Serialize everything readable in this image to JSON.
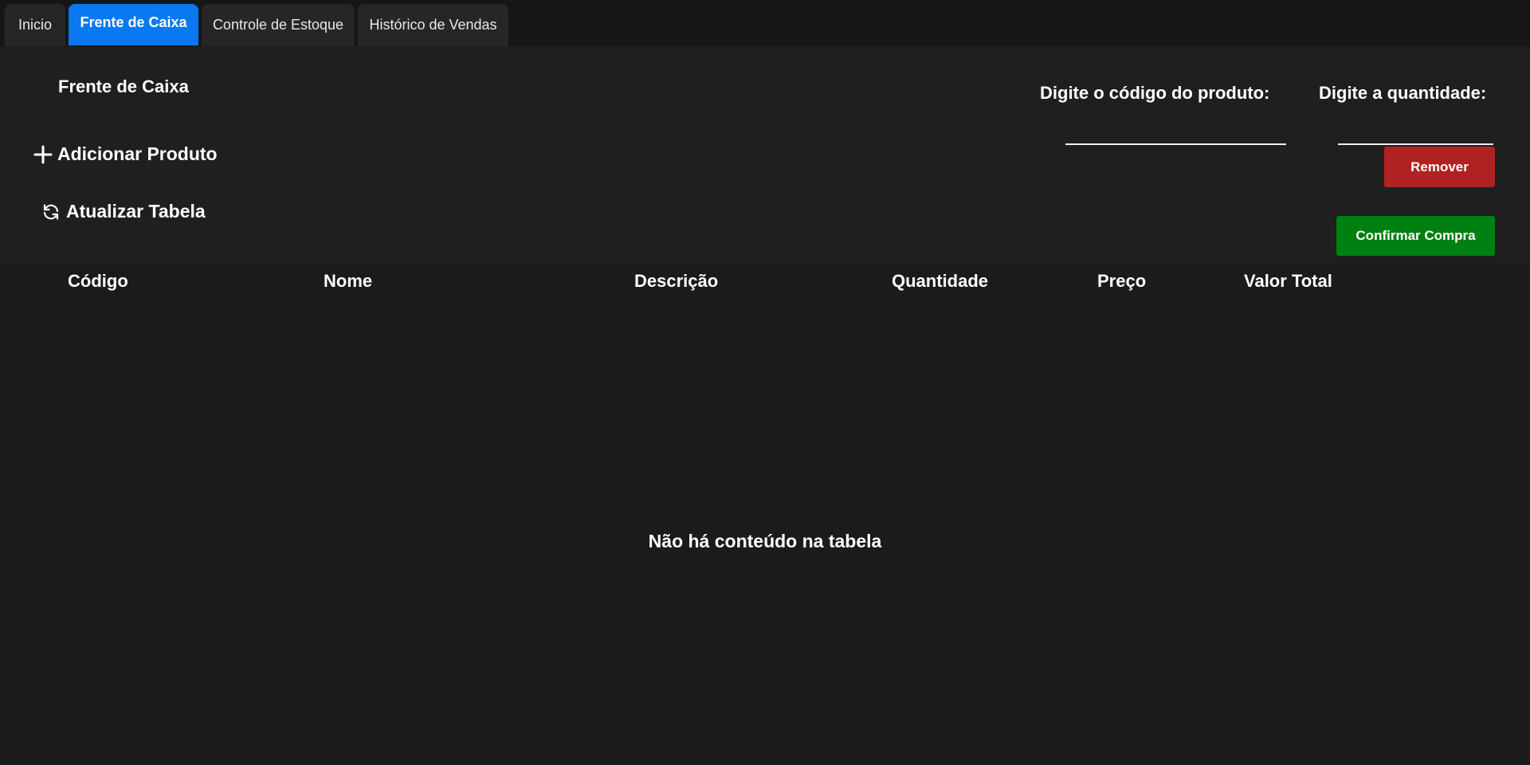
{
  "tabs": [
    {
      "label": "Inicio"
    },
    {
      "label": "Frente de Caixa"
    },
    {
      "label": "Controle de Estoque"
    },
    {
      "label": "Histórico de Vendas"
    }
  ],
  "active_tab": "Frente de Caixa",
  "page": {
    "title": "Frente de Caixa"
  },
  "actions": {
    "add_product": "Adicionar Produto",
    "refresh_table": "Atualizar Tabela"
  },
  "form": {
    "product_code_label": "Digite o código do produto:",
    "product_code_value": "",
    "quantity_label": "Digite a quantidade:",
    "quantity_value": ""
  },
  "buttons": {
    "remove": "Remover",
    "confirm_purchase": "Confirmar Compra"
  },
  "table": {
    "columns": [
      "Código",
      "Nome",
      "Descrição",
      "Quantidade",
      "Preço",
      "Valor Total"
    ],
    "rows": [],
    "empty_message": "Não há conteúdo na tabela"
  },
  "colors": {
    "active_tab": "#0a78f0",
    "remove_button": "#b02121",
    "confirm_button": "#008010",
    "background": "#1b1b1b"
  }
}
